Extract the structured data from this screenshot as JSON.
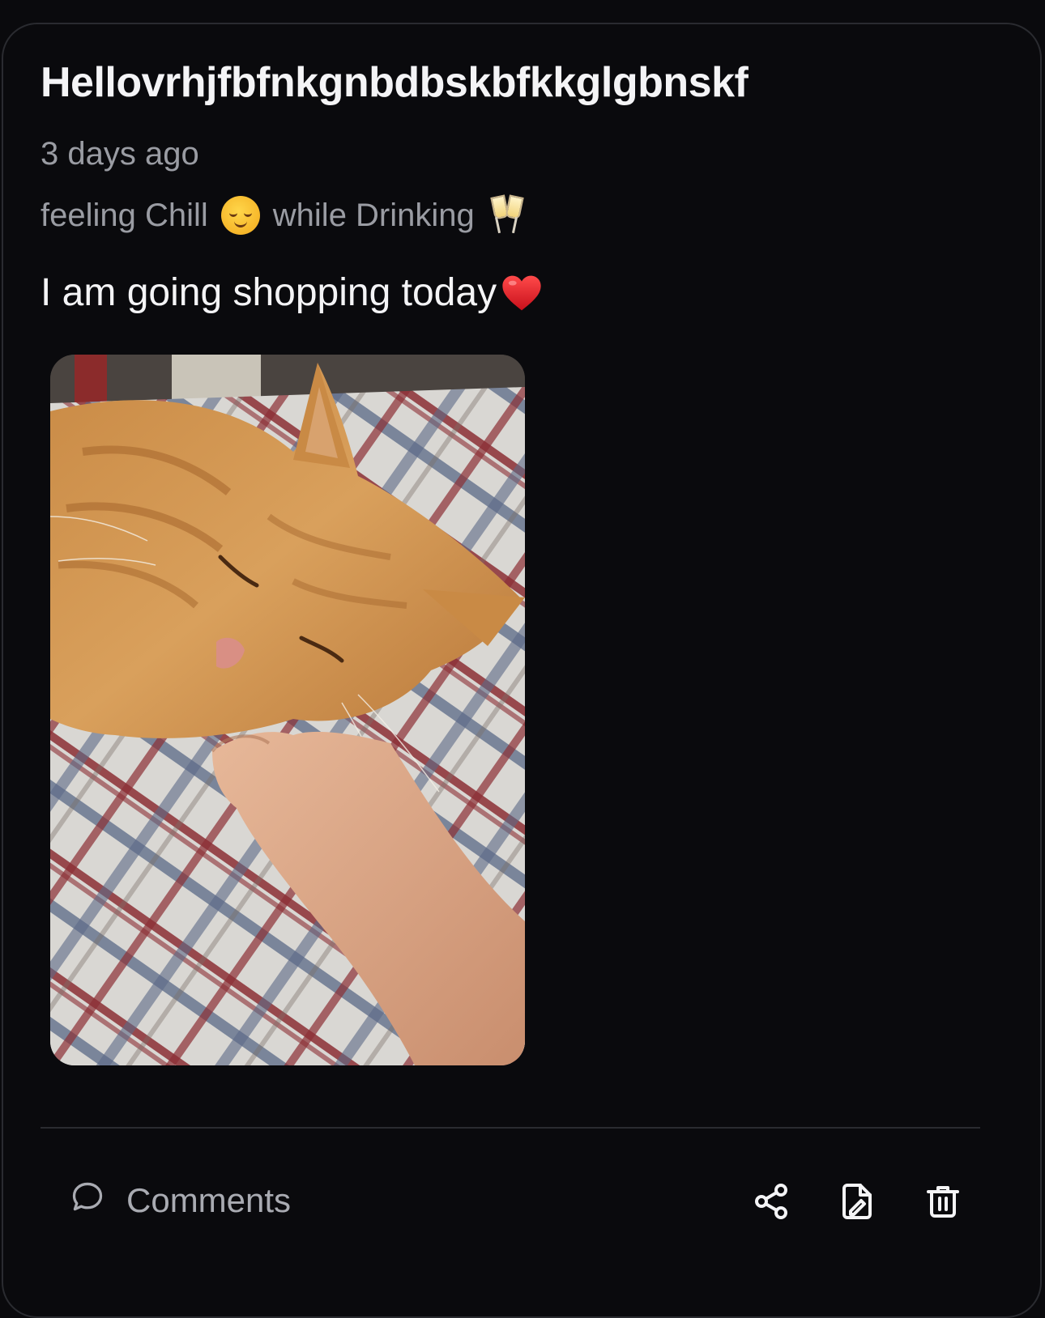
{
  "post": {
    "title": "Hellovrhjfbfnkgnbdbskbfkkglgbnskf",
    "timestamp": "3 days ago",
    "feeling_label": "feeling Chill",
    "feeling_icon": "relieved-face-icon",
    "activity_label": "while Drinking",
    "activity_icon": "clinking-glasses-icon",
    "body": "I am going shopping today",
    "body_emoji_icon": "red-heart-icon",
    "image_icon": "sleeping-orange-cat-photo"
  },
  "footer": {
    "comments_label": "Comments",
    "comments_icon": "speech-bubble-icon",
    "share_icon": "share-icon",
    "edit_icon": "edit-document-icon",
    "delete_icon": "trash-icon"
  },
  "colors": {
    "background": "#0a0a0d",
    "border": "#2a2b30",
    "title_text": "#f4f4f6",
    "muted_text": "#9a9ca3",
    "heart": "#e3202b"
  }
}
